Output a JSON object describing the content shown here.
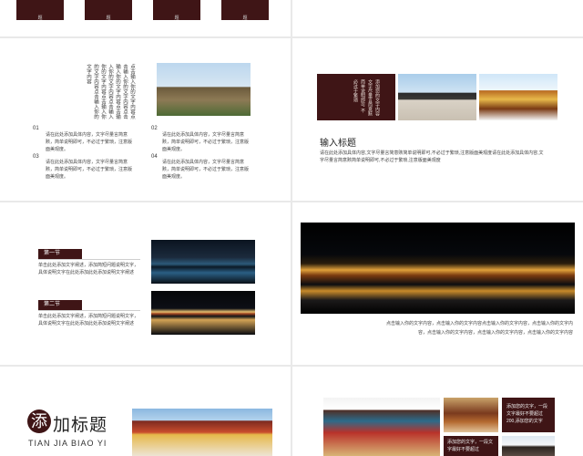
{
  "top": {
    "left_boxes": [
      "题",
      "题",
      "题",
      "题"
    ]
  },
  "slide1": {
    "vertical_text": [
      "点击输入你的文字内容点",
      "击输入你的文字内容点击",
      "输入你的文字内容点击输",
      "入你的文字内容点击输入",
      "你的文字内容点击输入你",
      "的文字内容点击输入你的",
      "文字内容"
    ],
    "items": [
      {
        "num": "01",
        "text": "请在此处添加具体内容，文字尽量言简意赅，简单说明即可，不必过于繁琐，注意版面美观度。"
      },
      {
        "num": "02",
        "text": "请在此处添加具体内容，文字尽量言简意赅，简单说明即可，不必过于繁琐，注意版面美观度。"
      },
      {
        "num": "03",
        "text": "请在此处添加具体内容，文字尽量言简意赅，简单说明即可，不必过于繁琐，注意版面美观度。"
      },
      {
        "num": "04",
        "text": "请在此处添加具体内容，文字尽量言简意赅，简单说明即可，不必过于繁琐，注意版面美观度。"
      }
    ]
  },
  "slide2": {
    "vertical_box_text": [
      "添加您的文字内容",
      "文字尽量言简意赅",
      "简单说明即可",
      "不必过于繁琐"
    ],
    "heading": "输入标题",
    "body": "请在此处添加具体内容,文字尽量言简意赅简单说明即可,不必过于繁琐,注意版面美观度请在此处添加具体内容,文字尽量言简意赅简单说明即可,不必过于繁琐,注意版面美观度"
  },
  "slide3": {
    "section1_title": "第一节",
    "section1_text": "单击此处添加文字阐述，添加简短问题说明文字，具体说明文字在此处添加此处添加说明文字阐述",
    "section2_title": "第二节",
    "section2_text": "单击此处添加文字阐述，添加简短问题说明文字，具体说明文字在此处添加此处添加说明文字阐述"
  },
  "slide4": {
    "caption": "点击输入你的文字内容，点击输入你的文字内容点击输入你的文字内容，点击输入你的文字内容，点击输入你的文字内容，点击输入你的文字内容，点击输入你的文字内容"
  },
  "slide5": {
    "title_first_char": "添",
    "title_rest": "加标题",
    "subtitle": "TIAN JIA BIAO YI"
  },
  "slide6": {
    "box1_text": "添加您的文字，一段文字最好不要超过200,添加您的文字",
    "box2_text": "添加您的文字，一段文字最好不要超过"
  }
}
